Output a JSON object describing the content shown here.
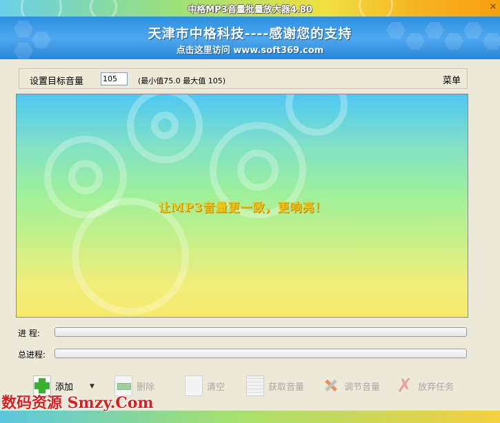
{
  "window": {
    "title": "中格MP3音量批量放大器4.80",
    "close_label": "✕"
  },
  "banner": {
    "line1": "天津市中格科技----感谢您的支持",
    "line2": "点击这里访问 www.soft369.com"
  },
  "settings": {
    "target_label": "设置目标音量",
    "target_value": "105",
    "range_text": "(最小值75.0  最大值 105)",
    "menu_label": "菜单"
  },
  "display": {
    "slogan": "让MP3音量更一致，更响亮！"
  },
  "progress": {
    "current_label": "进  程:",
    "current_value": 0,
    "total_label": "总进程:",
    "total_value": 0
  },
  "toolbar": {
    "add_label": "添加",
    "delete_label": "删除",
    "clear_label": "清空",
    "get_volume_label": "获取音量",
    "adjust_volume_label": "调节音量",
    "cancel_task_label": "放弃任务"
  },
  "watermark": "数码资源 Smzy.Com"
}
